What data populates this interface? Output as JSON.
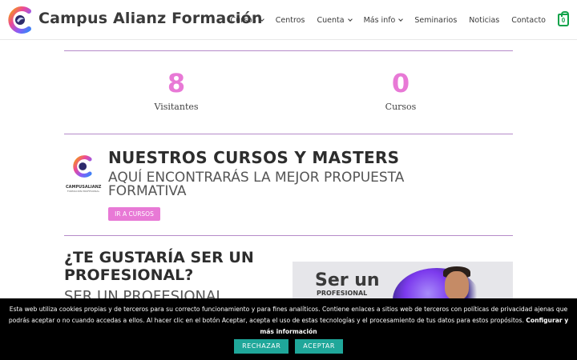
{
  "header": {
    "site_title": "Campus Alianz Formación",
    "nav": [
      {
        "label": "Cursos",
        "has_dropdown": true
      },
      {
        "label": "Centros",
        "has_dropdown": false
      },
      {
        "label": "Cuenta",
        "has_dropdown": true
      },
      {
        "label": "Más info",
        "has_dropdown": true
      },
      {
        "label": "Seminarios",
        "has_dropdown": false
      },
      {
        "label": "Noticias",
        "has_dropdown": false
      },
      {
        "label": "Contacto",
        "has_dropdown": false
      }
    ],
    "cart_count": "0",
    "icons": {
      "logo": "campus-alianz-logo",
      "cart": "shopping-bag-icon",
      "dropdown": "chevron-down-icon"
    }
  },
  "stats": [
    {
      "value": "8",
      "label": "Visitantes"
    },
    {
      "value": "0",
      "label": "Cursos"
    }
  ],
  "courses": {
    "logo_brand": "CAMPUSALIANZ",
    "logo_sub": "FORMACIÓN PROFESIONAL",
    "title": "NUESTROS CURSOS Y MASTERS",
    "subtitle": "AQUÍ ENCONTRARÁS LA MEJOR PROPUESTA FORMATIVA",
    "button": "IR A CURSOS"
  },
  "professional": {
    "title": "¿TE GUSTARÍA SER UN PROFESIONAL?",
    "subtitle": "SER UN PROFESIONAL",
    "promo_line1": "Ser un",
    "promo_line2": "PROFESIONAL"
  },
  "cookie": {
    "text": "Esta web utiliza cookies propias y de terceros para su correcto funcionamiento y para fines analíticos. Contiene enlaces a sitios web de terceros con políticas de privacidad ajenas que podrás aceptar o no cuando accedas a ellos. Al hacer clic en el botón Aceptar, acepta el uso de estas tecnologías y el procesamiento de tus datos para estos propósitos.",
    "link": "Configurar y más información",
    "reject": "RECHAZAR",
    "accept": "ACEPTAR"
  },
  "colors": {
    "accent_pink": "#e879d6",
    "divider_purple": "#b58ac9",
    "cookie_button": "#1fa79a",
    "cart_green": "#11a34a"
  }
}
